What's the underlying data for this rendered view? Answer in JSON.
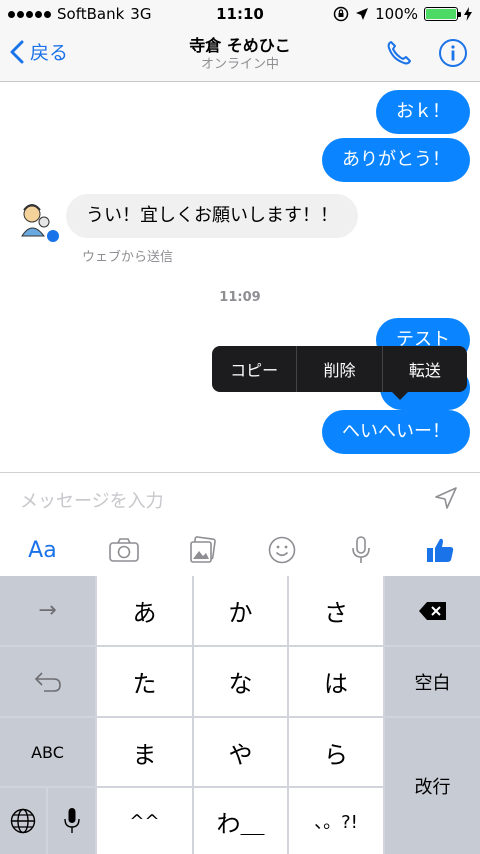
{
  "status": {
    "carrier": "SoftBank",
    "network": "3G",
    "time": "11:10",
    "battery": "100%"
  },
  "nav": {
    "back_label": "戻る",
    "title": "寺倉 そめひこ",
    "subtitle": "オンライン中"
  },
  "messages": {
    "out1": "おｋ！",
    "out2": "ありがとう！",
    "in1": "うい！宜しくお願いします！！",
    "in1_note": "ウェブから送信",
    "timestamp": "11:09",
    "out3": "テスト",
    "out4": "へいへいー！"
  },
  "popup": {
    "copy": "コピー",
    "delete": "削除",
    "forward": "転送"
  },
  "composer": {
    "placeholder": "メッセージを入力",
    "aa": "Aa"
  },
  "keyboard": {
    "row1": [
      "→",
      "あ",
      "か",
      "さ"
    ],
    "row2": [
      "た",
      "な",
      "は",
      "空白"
    ],
    "row3": [
      "ABC",
      "ま",
      "や",
      "ら",
      "改行"
    ],
    "row4": [
      "^^",
      "わ＿",
      "、。?!"
    ]
  },
  "colors": {
    "accent": "#1a73e8",
    "bubble_out": "#0a84ff",
    "battery": "#4cd964"
  }
}
